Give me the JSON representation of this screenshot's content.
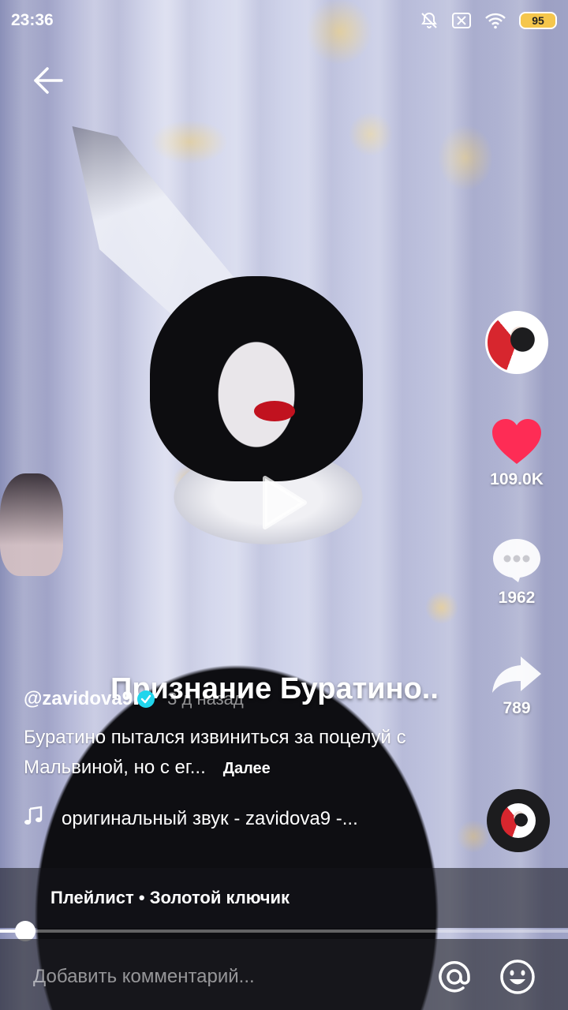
{
  "status_bar": {
    "time": "23:36",
    "battery": "95",
    "icons": [
      "mute-icon",
      "sim-off-icon",
      "wifi-icon",
      "battery-icon"
    ]
  },
  "video": {
    "title_overlay": "Признание Буратино..",
    "playing": false
  },
  "rail": {
    "likes": "109.0K",
    "comments": "1962",
    "shares": "789"
  },
  "caption": {
    "author": "@zavidova9",
    "time_ago": "3 д назад",
    "description": "Буратино пытался извиниться за поцелуй с Мальвиной, но с ег...",
    "more": "Далее",
    "sound": "оригинальный звук - zavidova9 -..."
  },
  "playlist": {
    "label": "Плейлист • Золотой ключик"
  },
  "progress": {
    "fraction": 0.045
  },
  "comment_bar": {
    "placeholder": "Добавить комментарий..."
  },
  "colors": {
    "like": "#fe2c55",
    "verified": "#20d5ec",
    "battery": "#f5c64c"
  }
}
